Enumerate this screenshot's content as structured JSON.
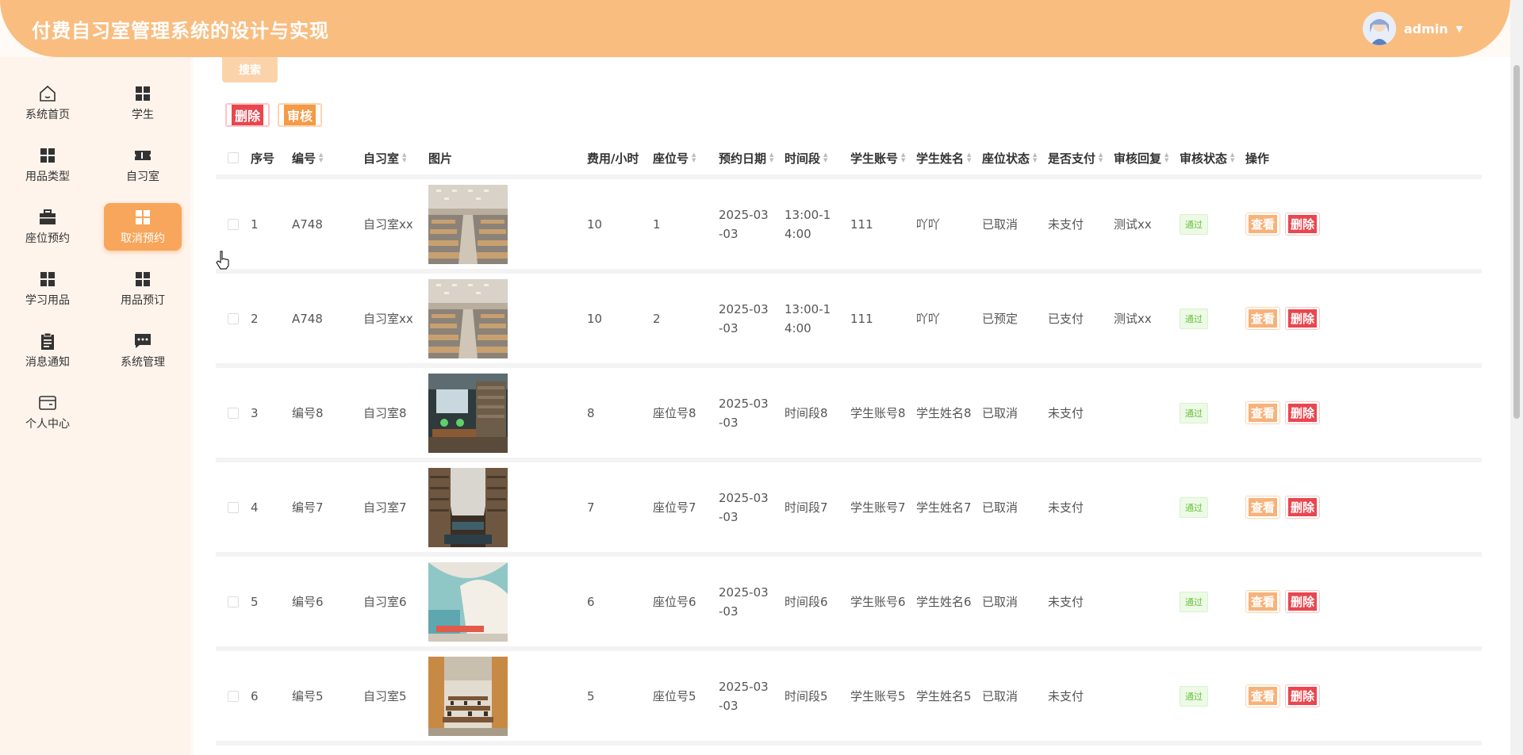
{
  "header": {
    "title": "付费自习室管理系统的设计与实现",
    "username": "admin"
  },
  "sidebar": {
    "items": [
      {
        "label": "系统首页",
        "icon": "home-icon"
      },
      {
        "label": "学生",
        "icon": "grid-icon"
      },
      {
        "label": "用品类型",
        "icon": "grid-icon"
      },
      {
        "label": "自习室",
        "icon": "ticket-icon"
      },
      {
        "label": "座位预约",
        "icon": "briefcase-icon"
      },
      {
        "label": "取消预约",
        "icon": "grid-icon",
        "active": true
      },
      {
        "label": "学习用品",
        "icon": "grid-icon"
      },
      {
        "label": "用品预订",
        "icon": "grid-icon"
      },
      {
        "label": "消息通知",
        "icon": "clipboard-icon"
      },
      {
        "label": "系统管理",
        "icon": "chat-icon"
      },
      {
        "label": "个人中心",
        "icon": "card-icon"
      }
    ]
  },
  "toolbar": {
    "search_label": "搜索",
    "delete_label": "删除",
    "audit_label": "审核"
  },
  "table": {
    "columns": [
      "序号",
      "编号",
      "自习室",
      "图片",
      "费用/小时",
      "座位号",
      "预约日期",
      "时间段",
      "学生账号",
      "学生姓名",
      "座位状态",
      "是否支付",
      "审核回复",
      "审核状态",
      "操作"
    ],
    "rows": [
      {
        "idx": "1",
        "code": "A748",
        "room": "自习室xx",
        "fee": "10",
        "seat": "1",
        "date": "2025-03-03",
        "time": "13:00-14:00",
        "account": "111",
        "name": "吖吖",
        "status": "已取消",
        "paid": "未支付",
        "reply": "测试xx",
        "audit": "通过"
      },
      {
        "idx": "2",
        "code": "A748",
        "room": "自习室xx",
        "fee": "10",
        "seat": "2",
        "date": "2025-03-03",
        "time": "13:00-14:00",
        "account": "111",
        "name": "吖吖",
        "status": "已预定",
        "paid": "已支付",
        "reply": "测试xx",
        "audit": "通过"
      },
      {
        "idx": "3",
        "code": "编号8",
        "room": "自习室8",
        "fee": "8",
        "seat": "座位号8",
        "date": "2025-03-03",
        "time": "时间段8",
        "account": "学生账号8",
        "name": "学生姓名8",
        "status": "已取消",
        "paid": "未支付",
        "reply": "",
        "audit": "通过"
      },
      {
        "idx": "4",
        "code": "编号7",
        "room": "自习室7",
        "fee": "7",
        "seat": "座位号7",
        "date": "2025-03-03",
        "time": "时间段7",
        "account": "学生账号7",
        "name": "学生姓名7",
        "status": "已取消",
        "paid": "未支付",
        "reply": "",
        "audit": "通过"
      },
      {
        "idx": "5",
        "code": "编号6",
        "room": "自习室6",
        "fee": "6",
        "seat": "座位号6",
        "date": "2025-03-03",
        "time": "时间段6",
        "account": "学生账号6",
        "name": "学生姓名6",
        "status": "已取消",
        "paid": "未支付",
        "reply": "",
        "audit": "通过"
      },
      {
        "idx": "6",
        "code": "编号5",
        "room": "自习室5",
        "fee": "5",
        "seat": "座位号5",
        "date": "2025-03-03",
        "time": "时间段5",
        "account": "学生账号5",
        "name": "学生姓名5",
        "status": "已取消",
        "paid": "未支付",
        "reply": "",
        "audit": "通过"
      }
    ],
    "view_label": "查看",
    "delete_label": "删除"
  }
}
